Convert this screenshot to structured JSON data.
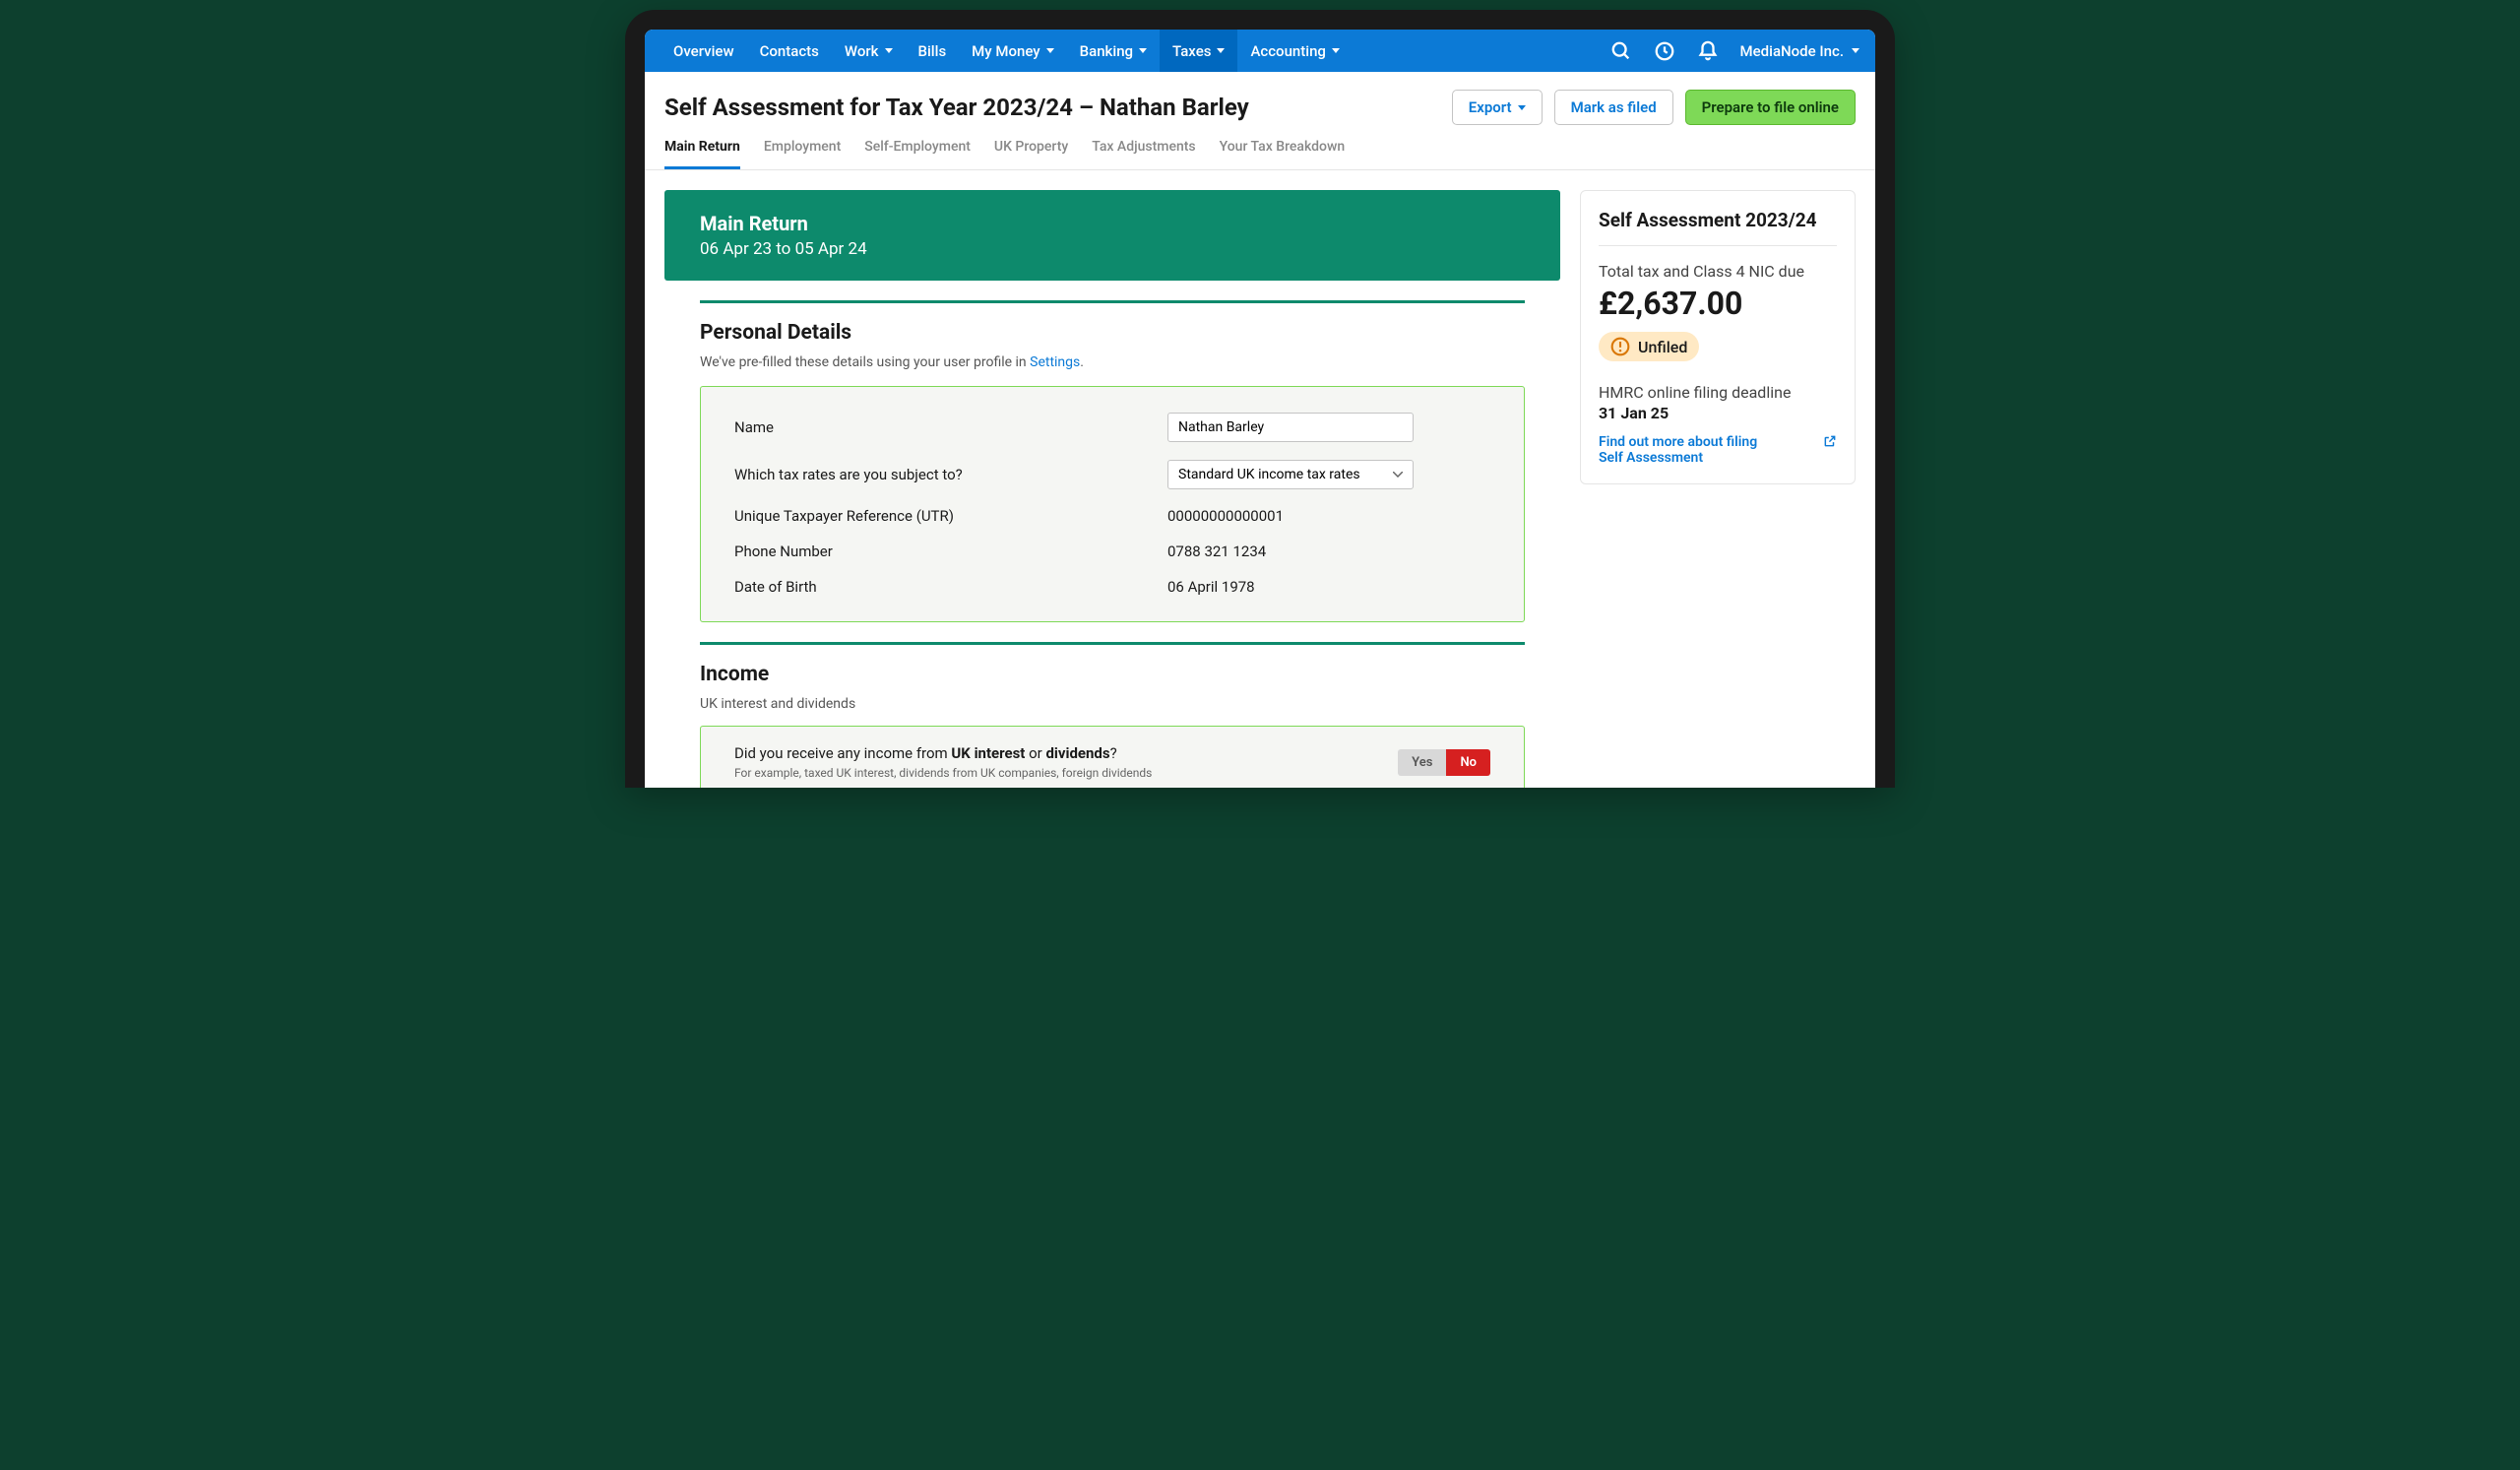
{
  "nav": {
    "items": [
      {
        "label": "Overview",
        "dropdown": false
      },
      {
        "label": "Contacts",
        "dropdown": false
      },
      {
        "label": "Work",
        "dropdown": true
      },
      {
        "label": "Bills",
        "dropdown": false
      },
      {
        "label": "My Money",
        "dropdown": true
      },
      {
        "label": "Banking",
        "dropdown": true
      },
      {
        "label": "Taxes",
        "dropdown": true,
        "active": true
      },
      {
        "label": "Accounting",
        "dropdown": true
      }
    ],
    "company": "MediaNode Inc."
  },
  "header": {
    "title": "Self Assessment for Tax Year 2023/24 – Nathan Barley",
    "buttons": {
      "export": "Export",
      "mark_filed": "Mark as filed",
      "prepare": "Prepare to file online"
    }
  },
  "tabs": [
    {
      "label": "Main Return",
      "active": true
    },
    {
      "label": "Employment"
    },
    {
      "label": "Self-Employment"
    },
    {
      "label": "UK Property"
    },
    {
      "label": "Tax Adjustments"
    },
    {
      "label": "Your Tax Breakdown"
    }
  ],
  "banner": {
    "title": "Main Return",
    "subtitle": "06 Apr 23 to 05 Apr 24"
  },
  "personal": {
    "title": "Personal Details",
    "subtitle_pre": "We've pre-filled these details using your user profile in ",
    "subtitle_link": "Settings",
    "subtitle_post": ".",
    "name_label": "Name",
    "name_value": "Nathan Barley",
    "rates_label": "Which tax rates are you subject to?",
    "rates_value": "Standard UK income tax rates",
    "utr_label": "Unique Taxpayer Reference (UTR)",
    "utr_value": "00000000000001",
    "phone_label": "Phone Number",
    "phone_value": "0788 321 1234",
    "dob_label": "Date of Birth",
    "dob_value": "06 April 1978"
  },
  "income": {
    "title": "Income",
    "subtitle": "UK interest and dividends",
    "question_pre": "Did you receive any income from ",
    "question_b1": "UK interest",
    "question_mid": " or ",
    "question_b2": "dividends",
    "question_post": "?",
    "hint": "For example, taxed UK interest, dividends from UK companies, foreign dividends",
    "yes": "Yes",
    "no": "No"
  },
  "sidebar": {
    "title": "Self Assessment 2023/24",
    "total_label": "Total tax and Class 4 NIC due",
    "total_amount": "£2,637.00",
    "status": "Unfiled",
    "deadline_label": "HMRC online filing deadline",
    "deadline_date": "31 Jan 25",
    "link": "Find out more about filing Self Assessment"
  }
}
